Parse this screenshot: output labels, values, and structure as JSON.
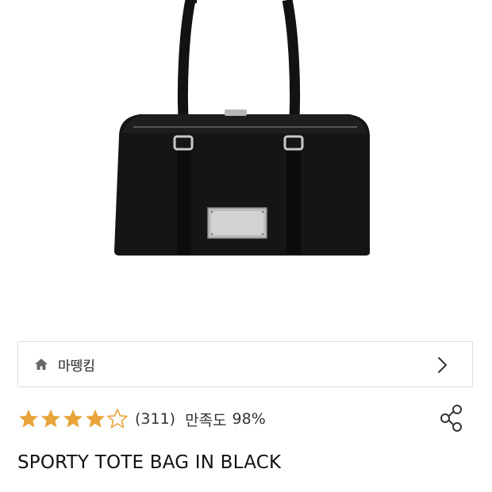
{
  "store": {
    "name": "마뗑킴",
    "home_icon": "home-icon",
    "arrow_icon": "chevron-right-icon"
  },
  "rating": {
    "stars": 4.5,
    "max_stars": 5,
    "count_text": "(311)",
    "satisfaction_label": "만족도",
    "satisfaction_value": "98%",
    "star_color": "#e8a43a"
  },
  "share": {
    "icon": "share-icon"
  },
  "product": {
    "title": "SPORTY TOTE BAG IN BLACK"
  }
}
